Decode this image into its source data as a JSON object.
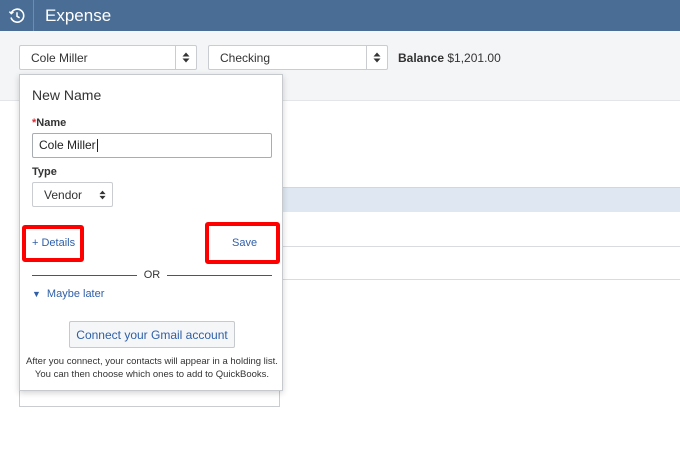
{
  "app": {
    "title": "Expense"
  },
  "header": {
    "payee_value": "Cole Miller",
    "account_value": "Checking",
    "balance_label": "Balance",
    "balance_value": "$1,201.00"
  },
  "popup": {
    "heading": "New Name",
    "required_mark": "*",
    "name_label": "Name",
    "name_value": "Cole Miller",
    "type_label": "Type",
    "type_value": "Vendor",
    "details_link": "+ Details",
    "save_label": "Save",
    "or_text": "OR",
    "maybe_later": "Maybe later",
    "gmail_button": "Connect your Gmail account",
    "note_line1": "After you connect, your contacts will appear in a holding list.",
    "note_line2": "You can then choose which ones to add to QuickBooks."
  },
  "colors": {
    "topbar": "#4a6d95",
    "link": "#2f5fa7",
    "highlight": "#ff0000"
  },
  "icons": {
    "logo": "clock-history-icon",
    "select_arrow": "sort-arrows-icon",
    "maybe_toggle": "triangle-down-icon"
  }
}
